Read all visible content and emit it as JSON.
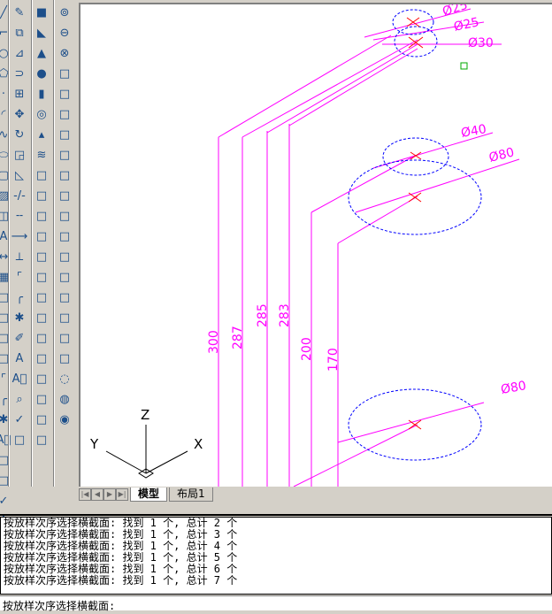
{
  "toolbars": [
    [
      "line",
      "polyline",
      "circle",
      "polygon",
      "point",
      "arc",
      "spline",
      "ellipse",
      "region",
      "hatch",
      "block",
      "text",
      "dimension",
      "table",
      "properties",
      "insert",
      "mtext",
      "multiline",
      "chamfer",
      "fillet",
      "explode",
      "text-style",
      "single-text",
      "text-edit",
      "spellcheck",
      "text-a"
    ],
    [
      "erase",
      "copy",
      "mirror",
      "offset",
      "array",
      "move",
      "rotate",
      "scale",
      "stretch",
      "trim",
      "break",
      "extend",
      "join",
      "chamfer",
      "fillet",
      "explode",
      "pencil",
      "text-a",
      "text-style",
      "find",
      "spellcheck",
      "text-small"
    ],
    [
      "box-3d",
      "wedge",
      "cone",
      "sphere",
      "cylinder",
      "torus",
      "pyramid",
      "helix",
      "planar-surface",
      "extrude",
      "presspull",
      "sweep",
      "revolve",
      "loft",
      "union-3d",
      "slice",
      "interfere",
      "section",
      "flatshot",
      "render",
      "material",
      "sun"
    ],
    [
      "union",
      "subtract",
      "intersect",
      "extrude-face",
      "move-face",
      "offset-face",
      "delete-face",
      "rotate-face",
      "taper-face",
      "copy-face",
      "color-face",
      "imprint",
      "separate",
      "shell",
      "check",
      "clean",
      "3d-wireframe",
      "hidden",
      "conceptual",
      "realistic",
      "shaded"
    ]
  ],
  "drawing": {
    "dims": [
      "300",
      "287",
      "285",
      "283",
      "200",
      "170"
    ],
    "diameters": [
      "Ø25",
      "Ø25",
      "Ø30",
      "Ø40",
      "Ø80",
      "Ø80"
    ],
    "axes": {
      "x": "X",
      "y": "Y",
      "z": "Z"
    }
  },
  "tabs": {
    "model": "模型",
    "layout1": "布局1"
  },
  "command": {
    "history": [
      "按放样次序选择横截面: 找到 1 个, 总计 2 个",
      "按放样次序选择横截面: 找到 1 个, 总计 3 个",
      "按放样次序选择横截面: 找到 1 个, 总计 4 个",
      "按放样次序选择横截面: 找到 1 个, 总计 5 个",
      "按放样次序选择横截面: 找到 1 个, 总计 6 个",
      "按放样次序选择横截面: 找到 1 个, 总计 7 个"
    ],
    "prompt": "按放样次序选择横截面:"
  },
  "colors": {
    "dim": "#ff00ff",
    "circle": "#0000ff",
    "cross": "#ff0000"
  }
}
